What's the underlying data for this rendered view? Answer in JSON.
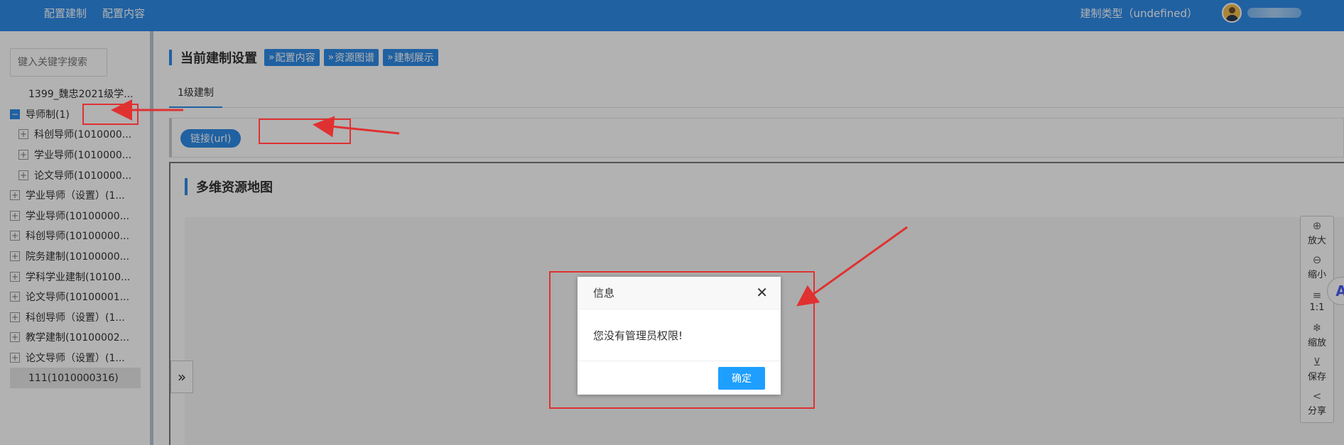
{
  "topbar": {
    "nav": [
      "配置建制",
      "配置内容"
    ],
    "build_type": "建制类型（undefined）",
    "avatar_icon": "user-avatar-icon"
  },
  "sidebar": {
    "search_placeholder": "键入关键字搜索",
    "nodes": [
      {
        "label": "1399_魏忠2021级学...",
        "toggle": "none",
        "level": 0
      },
      {
        "label": "导师制(1)",
        "toggle": "minus",
        "level": 0
      },
      {
        "label": "科创导师(1010000...",
        "toggle": "plus",
        "level": 1
      },
      {
        "label": "学业导师(1010000...",
        "toggle": "plus",
        "level": 1
      },
      {
        "label": "论文导师(1010000...",
        "toggle": "plus",
        "level": 1
      },
      {
        "label": "学业导师（设置）(1...",
        "toggle": "plus",
        "level": 0
      },
      {
        "label": "学业导师(10100000...",
        "toggle": "plus",
        "level": 0
      },
      {
        "label": "科创导师(10100000...",
        "toggle": "plus",
        "level": 0
      },
      {
        "label": "院务建制(10100000...",
        "toggle": "plus",
        "level": 0
      },
      {
        "label": "学科学业建制(10100...",
        "toggle": "plus",
        "level": 0
      },
      {
        "label": "论文导师(10100001...",
        "toggle": "plus",
        "level": 0
      },
      {
        "label": "科创导师（设置）(1...",
        "toggle": "plus",
        "level": 0
      },
      {
        "label": "教学建制(10100002...",
        "toggle": "plus",
        "level": 0
      },
      {
        "label": "论文导师（设置）(1...",
        "toggle": "plus",
        "level": 0
      },
      {
        "label": "111(1010000316)",
        "toggle": "none",
        "level": 0,
        "selected": true
      }
    ]
  },
  "main": {
    "section_title": "当前建制设置",
    "chips": [
      "配置内容",
      "资源图谱",
      "建制展示"
    ],
    "tab": "1级建制",
    "link_button": "链接(url)",
    "map_title": "多维资源地图"
  },
  "tools": [
    {
      "icon": "zoom-in-icon",
      "label": "放大"
    },
    {
      "icon": "zoom-out-icon",
      "label": "缩小"
    },
    {
      "icon": "actual-size-icon",
      "label": "1:1"
    },
    {
      "icon": "scale-icon",
      "label": "缩放"
    },
    {
      "icon": "save-icon",
      "label": "保存"
    },
    {
      "icon": "share-icon",
      "label": "分享"
    }
  ],
  "dialog": {
    "title": "信息",
    "message": "您没有管理员权限!",
    "confirm": "确定"
  },
  "colors": {
    "brand": "#2f8ce8",
    "confirm": "#1e9fff",
    "annotation": "#e03131"
  }
}
